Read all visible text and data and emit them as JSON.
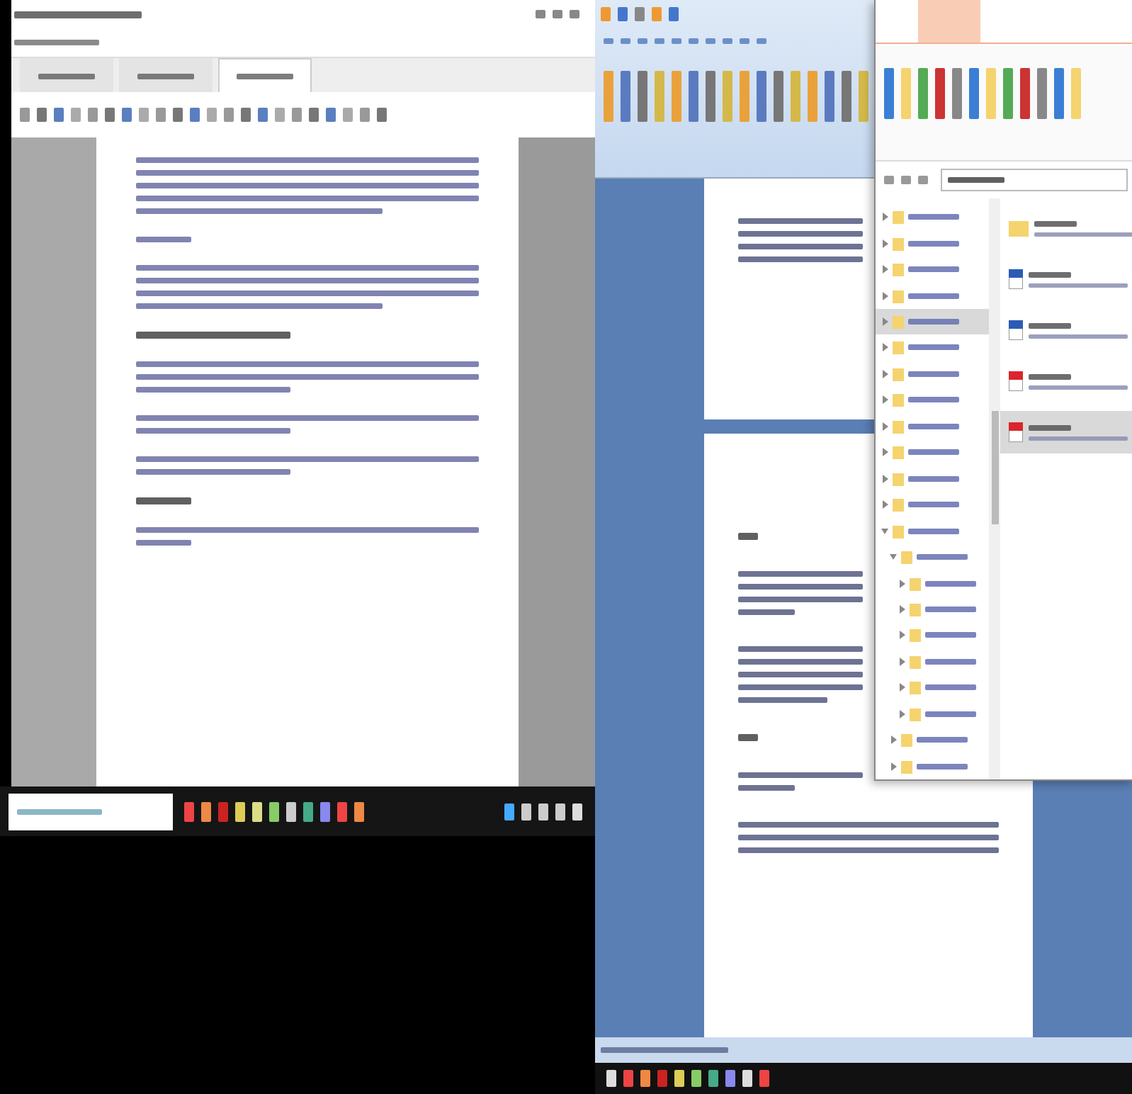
{
  "editor": {
    "tabs": [
      {
        "selected": false
      },
      {
        "selected": false
      },
      {
        "selected": true
      }
    ],
    "paragraphs": [
      {
        "kind": "body",
        "lines": [
          {
            "kind": "full"
          },
          {
            "kind": "full"
          },
          {
            "kind": "full"
          },
          {
            "kind": "full"
          },
          {
            "kind": "end"
          }
        ]
      },
      {
        "kind": "body",
        "lines": [
          {
            "kind": "short"
          }
        ]
      },
      {
        "kind": "body",
        "lines": [
          {
            "kind": "full"
          },
          {
            "kind": "full"
          },
          {
            "kind": "full"
          },
          {
            "kind": "end"
          }
        ]
      },
      {
        "kind": "heading",
        "lines": [
          {
            "kind": "half"
          }
        ]
      },
      {
        "kind": "body",
        "lines": [
          {
            "kind": "full"
          },
          {
            "kind": "full"
          },
          {
            "kind": "half"
          }
        ]
      },
      {
        "kind": "body",
        "lines": [
          {
            "kind": "full"
          },
          {
            "kind": "half"
          }
        ]
      },
      {
        "kind": "body",
        "lines": [
          {
            "kind": "full"
          },
          {
            "kind": "half"
          }
        ]
      },
      {
        "kind": "heading",
        "lines": [
          {
            "kind": "short"
          }
        ]
      },
      {
        "kind": "body",
        "lines": [
          {
            "kind": "full"
          },
          {
            "kind": "short"
          }
        ]
      }
    ]
  },
  "word": {
    "pages": [
      {
        "paragraphs": [
          {
            "kind": "body",
            "lines": [
              {
                "kind": "full"
              },
              {
                "kind": "full"
              },
              {
                "kind": "full"
              },
              {
                "kind": "full"
              }
            ]
          }
        ]
      },
      {
        "paragraphs": [
          {
            "kind": "heading",
            "lines": [
              {
                "kind": "short"
              }
            ]
          },
          {
            "kind": "body",
            "lines": [
              {
                "kind": "full"
              },
              {
                "kind": "full"
              },
              {
                "kind": "full"
              },
              {
                "kind": "half"
              }
            ]
          },
          {
            "kind": "body",
            "lines": [
              {
                "kind": "full"
              },
              {
                "kind": "full"
              },
              {
                "kind": "full"
              },
              {
                "kind": "full"
              },
              {
                "kind": "end"
              }
            ]
          },
          {
            "kind": "heading",
            "lines": [
              {
                "kind": "short"
              }
            ]
          },
          {
            "kind": "body",
            "lines": [
              {
                "kind": "full"
              },
              {
                "kind": "half"
              }
            ]
          },
          {
            "kind": "body",
            "lines": [
              {
                "kind": "full"
              },
              {
                "kind": "full"
              },
              {
                "kind": "full"
              }
            ]
          }
        ]
      }
    ]
  },
  "explorer": {
    "tree": [
      {
        "selected": false,
        "expanded": false
      },
      {
        "selected": false,
        "expanded": false
      },
      {
        "selected": false,
        "expanded": false
      },
      {
        "selected": false,
        "expanded": false
      },
      {
        "selected": true,
        "expanded": false
      },
      {
        "selected": false,
        "expanded": false
      },
      {
        "selected": false,
        "expanded": false
      },
      {
        "selected": false,
        "expanded": false
      },
      {
        "selected": false,
        "expanded": false
      },
      {
        "selected": false,
        "expanded": false
      },
      {
        "selected": false,
        "expanded": false
      },
      {
        "selected": false,
        "expanded": false
      },
      {
        "selected": false,
        "expanded": true,
        "children": [
          {
            "selected": false,
            "expanded": true,
            "children": [
              {
                "selected": false,
                "expanded": false
              },
              {
                "selected": false,
                "expanded": false
              },
              {
                "selected": false,
                "expanded": false
              },
              {
                "selected": false,
                "expanded": false
              },
              {
                "selected": false,
                "expanded": false
              },
              {
                "selected": false,
                "expanded": false
              }
            ]
          },
          {
            "selected": false,
            "expanded": false
          },
          {
            "selected": false,
            "expanded": false
          }
        ]
      }
    ],
    "files": [
      {
        "kind": "folder",
        "selected": false
      },
      {
        "kind": "word",
        "selected": false
      },
      {
        "kind": "word",
        "selected": false
      },
      {
        "kind": "pdf",
        "selected": false
      },
      {
        "kind": "pdf",
        "selected": true
      }
    ]
  }
}
